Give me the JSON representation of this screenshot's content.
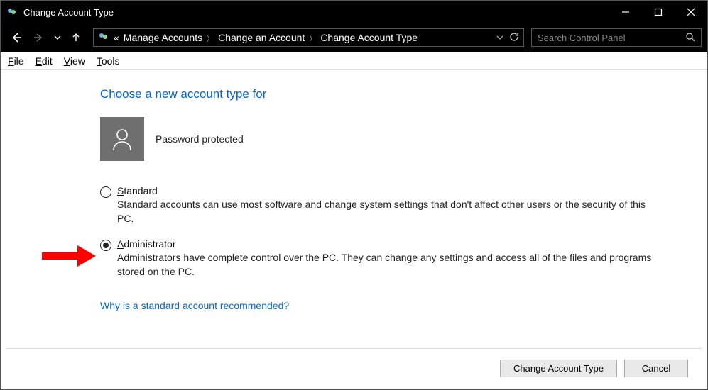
{
  "window": {
    "title": "Change Account Type"
  },
  "breadcrumb": {
    "prefix": "«",
    "items": [
      "Manage Accounts",
      "Change an Account",
      "Change Account Type"
    ]
  },
  "search": {
    "placeholder": "Search Control Panel"
  },
  "menu": {
    "file": "File",
    "edit": "Edit",
    "view": "View",
    "tools": "Tools"
  },
  "heading": "Choose a new account type for",
  "profile": {
    "status": "Password protected"
  },
  "options": {
    "standard": {
      "label": "Standard",
      "desc": "Standard accounts can use most software and change system settings that don't affect other users or the security of this PC.",
      "selected": false
    },
    "administrator": {
      "label": "Administrator",
      "desc": "Administrators have complete control over the PC. They can change any settings and access all of the files and programs stored on the PC.",
      "selected": true
    }
  },
  "link": "Why is a standard account recommended?",
  "buttons": {
    "change": "Change Account Type",
    "cancel": "Cancel"
  }
}
